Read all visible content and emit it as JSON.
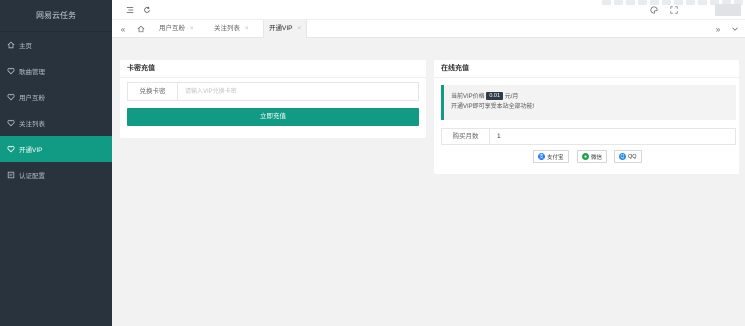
{
  "app": {
    "brand": "网易云任务"
  },
  "sidebar": {
    "items": [
      {
        "label": "主页",
        "icon": "home-icon"
      },
      {
        "label": "歌曲管理",
        "icon": "heart-icon"
      },
      {
        "label": "用户互粉",
        "icon": "heart-icon"
      },
      {
        "label": "关注列表",
        "icon": "heart-icon"
      },
      {
        "label": "开通VIP",
        "icon": "heart-icon",
        "active": true
      },
      {
        "label": "认证配置",
        "icon": "settings-icon"
      }
    ]
  },
  "header": {
    "menu_icon": "menu-icon",
    "refresh_icon": "refresh-icon",
    "theme_icon": "palette-icon",
    "fullscreen_icon": "fullscreen-icon"
  },
  "tabs": [
    {
      "label": "用户互粉",
      "closable": true
    },
    {
      "label": "关注列表",
      "closable": true
    },
    {
      "label": "开通VIP",
      "closable": true,
      "active": true
    }
  ],
  "card_recharge": {
    "title": "卡密充值",
    "field_label": "兑换卡密",
    "field_placeholder": "请输入VIP兑换卡密",
    "button": "立即充值"
  },
  "card_online": {
    "title": "在线充值",
    "price_prefix": "当前VIP价格",
    "price_value": "0.01",
    "price_suffix": "元/月",
    "notice_line2": "开通VIP即可享受本站全部功能!",
    "count_label": "购买月数",
    "count_value": "1",
    "pay_alipay": "支付宝",
    "pay_wechat": "微信",
    "pay_qq": "QQ"
  },
  "colors": {
    "accent": "#119b84",
    "sidebar": "#28333e"
  }
}
